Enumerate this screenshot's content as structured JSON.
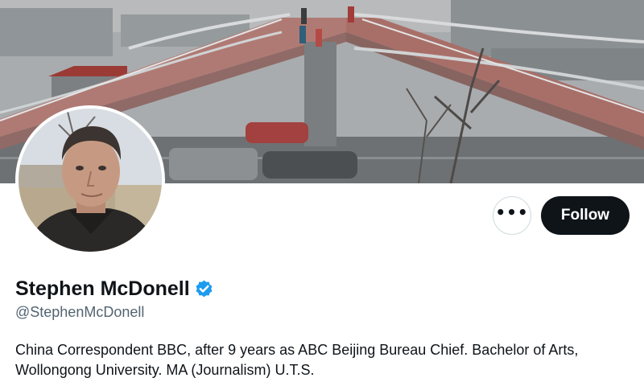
{
  "profile": {
    "display_name": "Stephen McDonell",
    "handle": "@StephenMcDonell",
    "bio": "China Correspondent BBC, after 9 years as ABC Beijing Bureau Chief. Bachelor of Arts, Wollongong University. MA (Journalism) U.T.S.",
    "verified": true
  },
  "actions": {
    "more_label": "•••",
    "follow_label": "Follow"
  },
  "banner": {
    "image_type": "photo",
    "subject": "pedestrian-overpass-with-traffic"
  },
  "icons": {
    "verified": "verified-badge-icon",
    "more": "more-options-icon"
  },
  "colors": {
    "follow_background": "#0f1419",
    "verified_blue": "#1d9bf0",
    "handle_gray": "#536471",
    "text_primary": "#0f1419"
  }
}
